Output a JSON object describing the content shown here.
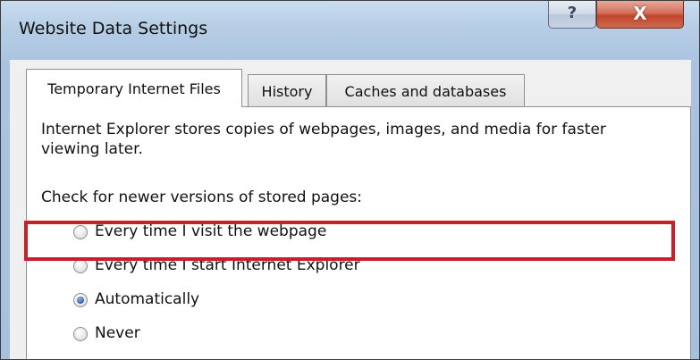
{
  "window": {
    "title": "Website Data Settings",
    "help_glyph": "?",
    "close_glyph": "X"
  },
  "tabs": [
    {
      "label": "Temporary Internet Files",
      "active": true
    },
    {
      "label": "History",
      "active": false
    },
    {
      "label": "Caches and databases",
      "active": false
    }
  ],
  "panel": {
    "description": "Internet Explorer stores copies of webpages, images, and media for faster viewing later.",
    "check_prompt": "Check for newer versions of stored pages:",
    "options": [
      {
        "label": "Every time I visit the webpage",
        "checked": false
      },
      {
        "label": "Every time I start Internet Explorer",
        "checked": false
      },
      {
        "label": "Automatically",
        "checked": true
      },
      {
        "label": "Never",
        "checked": false
      }
    ]
  },
  "colors": {
    "highlight_border": "#c8202a",
    "close_button": "#c0452c"
  },
  "icons": [
    "help-icon",
    "close-icon"
  ]
}
